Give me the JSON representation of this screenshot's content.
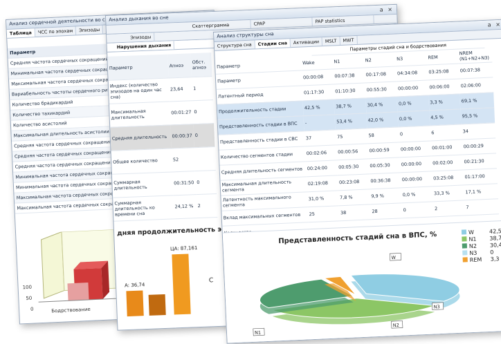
{
  "win1": {
    "title": "Анализ сердечной деятельности во сне",
    "controls": "a ×",
    "tabs": [
      "Таблица",
      "ЧСС по эпохам",
      "Эпизоды"
    ],
    "header": "Параметр",
    "rows": [
      "Средняя частота сердечных сокращений",
      "Минимальная частота сердечных сокращений",
      "Максимальная частота сердечных сокращений",
      "Вариабельность частоты сердечного ритма (sd)",
      "Количество брадикардий",
      "Количество тахикардий",
      "Количество асистолий",
      "Максимальная длительность асистолии",
      "Средняя частота сердечных сокращений",
      "Средняя частота сердечных сокращений",
      "Средняя частота сердечных сокращений",
      "Минимальная частота сердечных сокращений",
      "Минимальная частота сердечных сокращений",
      "Максимальная частота сердечных сокращений",
      "Максимальная частота сердечных сокращений"
    ],
    "chart": {
      "ticks": [
        "100",
        "50",
        "0"
      ],
      "xlabel": "Бодрствование"
    }
  },
  "win2": {
    "title": "Анализ дыхания во сне",
    "controls": "a ×",
    "tabs_top": [
      "Скаттерграмма",
      "CPAP",
      "PAP statistics"
    ],
    "tabs_row": [
      "Эпизоды"
    ],
    "subtab": "Нарушения дыхания",
    "headers": [
      "Параметр",
      "Апноэ",
      "Обст. апноэ"
    ],
    "rows": [
      [
        "Индекс (количество эпизодов на один час сна)",
        "23,64",
        "1"
      ],
      [
        "Максимальная длительность",
        "00:01:27",
        "0"
      ],
      [
        "Средняя длительность",
        "00:00:37",
        "0"
      ],
      [
        "Общее количество",
        "52",
        ""
      ],
      [
        "Суммарная длительность",
        "00:31:50",
        "0"
      ],
      [
        "Суммарная длительность ко времени сна",
        "24,12 %",
        "2"
      ]
    ],
    "chart": {
      "title": "дняя продолжительность э",
      "labels": [
        "A: 36,74",
        "ЦА: 87,161",
        "C"
      ]
    },
    "chart_data": {
      "type": "bar",
      "values": [
        36.74,
        30,
        87.161
      ],
      "labels": [
        "A: 36,74",
        "",
        "ЦА: 87,161"
      ]
    }
  },
  "win3": {
    "title": "Анализ структуры сна",
    "controls": "a ×",
    "tabs": [
      "Структура сна",
      "Стадии сна",
      "Активации",
      "MSLT",
      "MWT"
    ],
    "table_title": "Параметры стадий сна и бодрствования",
    "columns": [
      "Параметр",
      "Wake",
      "N1",
      "N2",
      "N3",
      "REM",
      "NREM (N1+N2+N3)"
    ],
    "rows": [
      [
        "Параметр",
        "00:00:08",
        "00:07:38",
        "00:17:08",
        "04:34:08",
        "03:25:08",
        "00:07:38"
      ],
      [
        "Латентный период",
        "01:17:30",
        "01:10:30",
        "00:55:30",
        "00:00:00",
        "00:06:00",
        "02:06:00"
      ],
      [
        "Продолжительность стадии",
        "42,5 %",
        "38,7 %",
        "30,4 %",
        "0,0 %",
        "3,3 %",
        "69,1 %"
      ],
      [
        "Представленность стадии в ВПС",
        "-",
        "53,4 %",
        "42,0 %",
        "0,0 %",
        "4,5 %",
        "95,5 %"
      ],
      [
        "Представленность стадии в СВС",
        "37",
        "75",
        "58",
        "0",
        "6",
        "34"
      ],
      [
        "Количество сегментов стадии",
        "00:02:06",
        "00:00:56",
        "00:00:59",
        "00:00:00",
        "00:01:00",
        "00:00:29"
      ],
      [
        "Средняя длительность сегментов",
        "00:24:00",
        "00:05:30",
        "00:05:30",
        "00:00:00",
        "00:02:00",
        "00:21:30"
      ],
      [
        "Максимальная длительность сегмента",
        "02:19:08",
        "00:23:08",
        "00:36:38",
        "00:00:00",
        "03:25:08",
        "01:17:00"
      ],
      [
        "Латентность максимального сегмента",
        "31,0 %",
        "7,8 %",
        "9,9 %",
        "0,0 %",
        "33,3 %",
        "17,1 %"
      ],
      [
        "Вклад максимальных сегментов",
        "25",
        "38",
        "28",
        "0",
        "2",
        "7"
      ],
      [
        "Количество",
        "",
        "",
        "",
        "",
        "",
        ""
      ]
    ],
    "chart_title": "Представленность стадий сна в ВПС, %",
    "legend": [
      {
        "label": "W",
        "value": "42,5",
        "color": "#8fcde3"
      },
      {
        "label": "N1",
        "value": "38,7",
        "color": "#8cc665"
      },
      {
        "label": "N2",
        "value": "30,4",
        "color": "#4e9c6e"
      },
      {
        "label": "N3",
        "value": "0",
        "color": "#b7e0f0"
      },
      {
        "label": "REM",
        "value": "3,3",
        "color": "#f0a030"
      }
    ],
    "slice_labels": [
      "W",
      "N1",
      "N2",
      "N3"
    ],
    "chart_data": {
      "type": "pie",
      "categories": [
        "W",
        "N1",
        "N2",
        "N3",
        "REM"
      ],
      "values": [
        42.5,
        38.7,
        30.4,
        0,
        3.3
      ],
      "title": "Представленность стадий сна в ВПС, %"
    }
  }
}
